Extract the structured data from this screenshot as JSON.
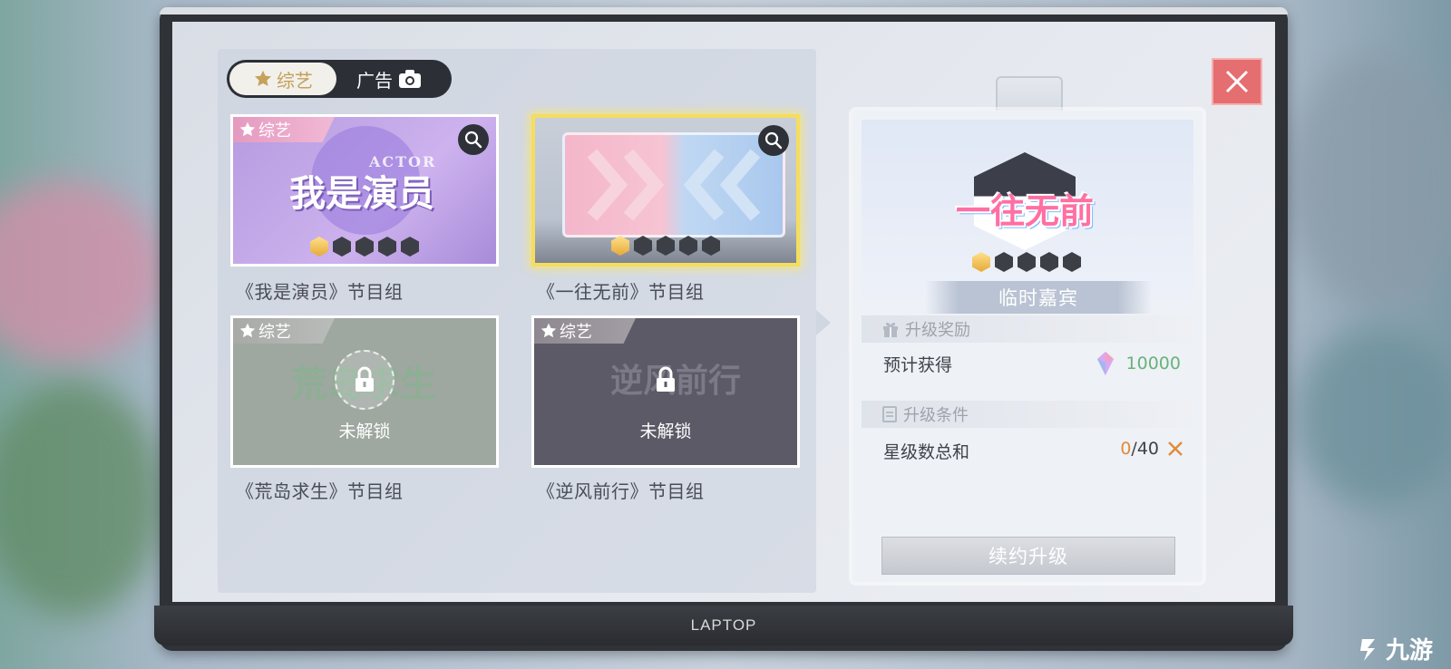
{
  "tabs": {
    "variety_label": "综艺",
    "ads_label": "广告"
  },
  "programs": [
    {
      "tag": "综艺",
      "logo": "我是演员",
      "logo_sub": "ACTOR",
      "label": "《我是演员》节目组",
      "rank_stars_filled": 1,
      "rank_stars_total": 5
    },
    {
      "tag": "",
      "logo": "",
      "label": "《一往无前》节目组",
      "rank_stars_filled": 1,
      "rank_stars_total": 5
    },
    {
      "tag": "综艺",
      "logo": "荒岛求生",
      "locked_text": "未解锁",
      "label": "《荒岛求生》节目组"
    },
    {
      "tag": "综艺",
      "logo": "逆风前行",
      "locked_text": "未解锁",
      "label": "《逆风前行》节目组"
    }
  ],
  "detail": {
    "logo": "一往无前",
    "rank": "临时嘉宾",
    "rank_stars_filled": 1,
    "rank_stars_total": 5,
    "reward_header": "升级奖励",
    "reward_label": "预计获得",
    "reward_value": "10000",
    "condition_header": "升级条件",
    "condition_label": "星级数总和",
    "condition_current": "0",
    "condition_target": "/40",
    "upgrade_button": "续约升级"
  },
  "laptop_brand": "LAPTOP",
  "watermark": "九游",
  "colors": {
    "accent_gold": "#f4dd60",
    "tag_pink": "#e59ac0",
    "close_red": "#e56e70",
    "reward_green": "#69b27b"
  },
  "icons": [
    "star-icon",
    "camera-icon",
    "search-icon",
    "lock-icon",
    "close-icon",
    "gift-icon",
    "document-icon",
    "crystal-icon",
    "x-mark-icon"
  ]
}
